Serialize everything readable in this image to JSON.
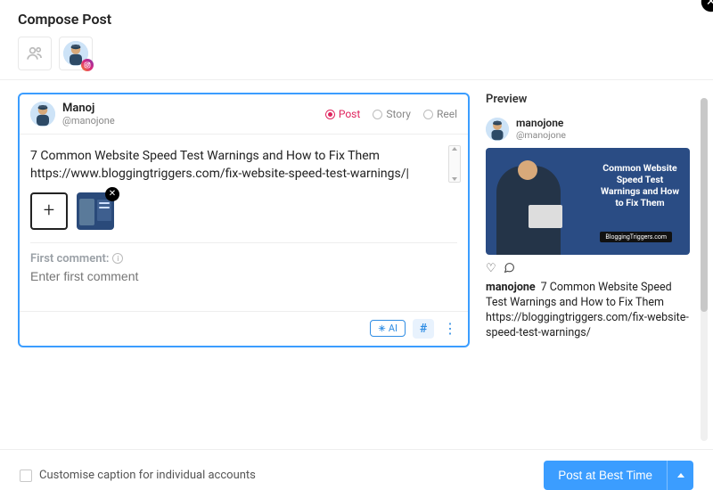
{
  "title": "Compose Post",
  "author": {
    "name": "Manoj",
    "handle": "@manojone"
  },
  "post_types": {
    "post": "Post",
    "story": "Story",
    "reel": "Reel"
  },
  "compose": {
    "text": "7 Common Website Speed Test Warnings and How to Fix Them https://www.bloggingtriggers.com/fix-website-speed-test-warnings/|"
  },
  "first_comment": {
    "label": "First comment:",
    "placeholder": "Enter first comment"
  },
  "tools": {
    "ai": "AI",
    "hash": "#"
  },
  "customise_label": "Customise caption for individual accounts",
  "post_button": "Post at Best Time",
  "preview": {
    "title": "Preview",
    "username": "manojone",
    "handle": "@manojone",
    "image_headline": "Common Website Speed Test Warnings and How to Fix Them",
    "image_badge": "BloggingTriggers.com",
    "caption_user": "manojone",
    "caption_text": "7 Common Website Speed Test Warnings and How to Fix Them https://bloggingtriggers.com/fix-website-speed-test-warnings/"
  }
}
